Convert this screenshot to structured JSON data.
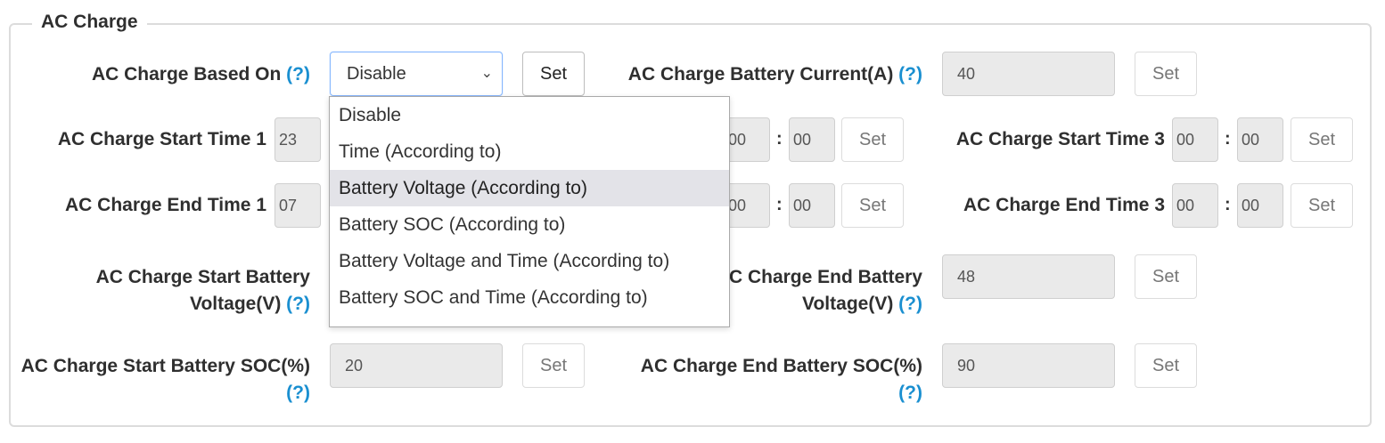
{
  "section": {
    "title": "AC Charge"
  },
  "help_mark": "(?)",
  "set_label": "Set",
  "time_colon": ":",
  "based_on": {
    "label": "AC Charge Based On",
    "selected": "Disable",
    "options": [
      "Disable",
      "Time (According to)",
      "Battery Voltage (According to)",
      "Battery SOC (According to)",
      "Battery Voltage and Time (According to)",
      "Battery SOC and Time (According to)"
    ],
    "highlighted_option": "Battery Voltage (According to)"
  },
  "battery_current": {
    "label": "AC Charge Battery Current(A)",
    "value": "40"
  },
  "start_time_1": {
    "label": "AC Charge Start Time 1",
    "hour": "23"
  },
  "start_time_2": {
    "hour": "00",
    "minute": "00"
  },
  "start_time_3": {
    "label": "AC Charge Start Time 3",
    "hour": "00",
    "minute": "00"
  },
  "end_time_1": {
    "label": "AC Charge End Time 1",
    "hour": "07"
  },
  "end_time_2": {
    "hour": "00",
    "minute": "00"
  },
  "end_time_3": {
    "label": "AC Charge End Time 3",
    "hour": "00",
    "minute": "00"
  },
  "start_voltage": {
    "label_line1": "AC Charge Start Battery",
    "label_line2": "Voltage(V)"
  },
  "end_voltage": {
    "label_line1": "AC Charge End Battery",
    "label_line2": "Voltage(V)",
    "value": "48"
  },
  "start_soc": {
    "label": "AC Charge Start Battery SOC(%)",
    "value": "20"
  },
  "end_soc": {
    "label": "AC Charge End Battery SOC(%)",
    "value": "90"
  }
}
